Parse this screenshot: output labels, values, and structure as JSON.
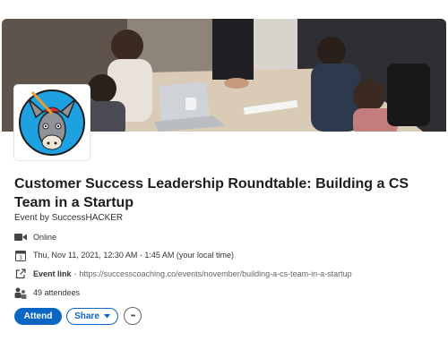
{
  "event": {
    "title": "Customer Success Leadership Roundtable: Building a CS Team in a Startup",
    "organizer": "Event by SuccessHACKER",
    "location_type": "Online",
    "datetime": "Thu, Nov 11, 2021, 12:30 AM - 1:45 AM (your local time)",
    "link_label": "Event link",
    "link_url": "https://successcoaching.co/events/november/building-a-cs-team-in-a-startup",
    "attendees": "49 attendees"
  },
  "actions": {
    "attend": "Attend",
    "share": "Share",
    "more": "•••"
  },
  "icons": {
    "video": "video-camera-icon",
    "calendar": "calendar-icon",
    "link": "external-link-icon",
    "people": "people-icon",
    "dropdown": "caret-down-icon"
  },
  "colors": {
    "primary": "#0a66c2",
    "logo_bg": "#1da1e0"
  }
}
